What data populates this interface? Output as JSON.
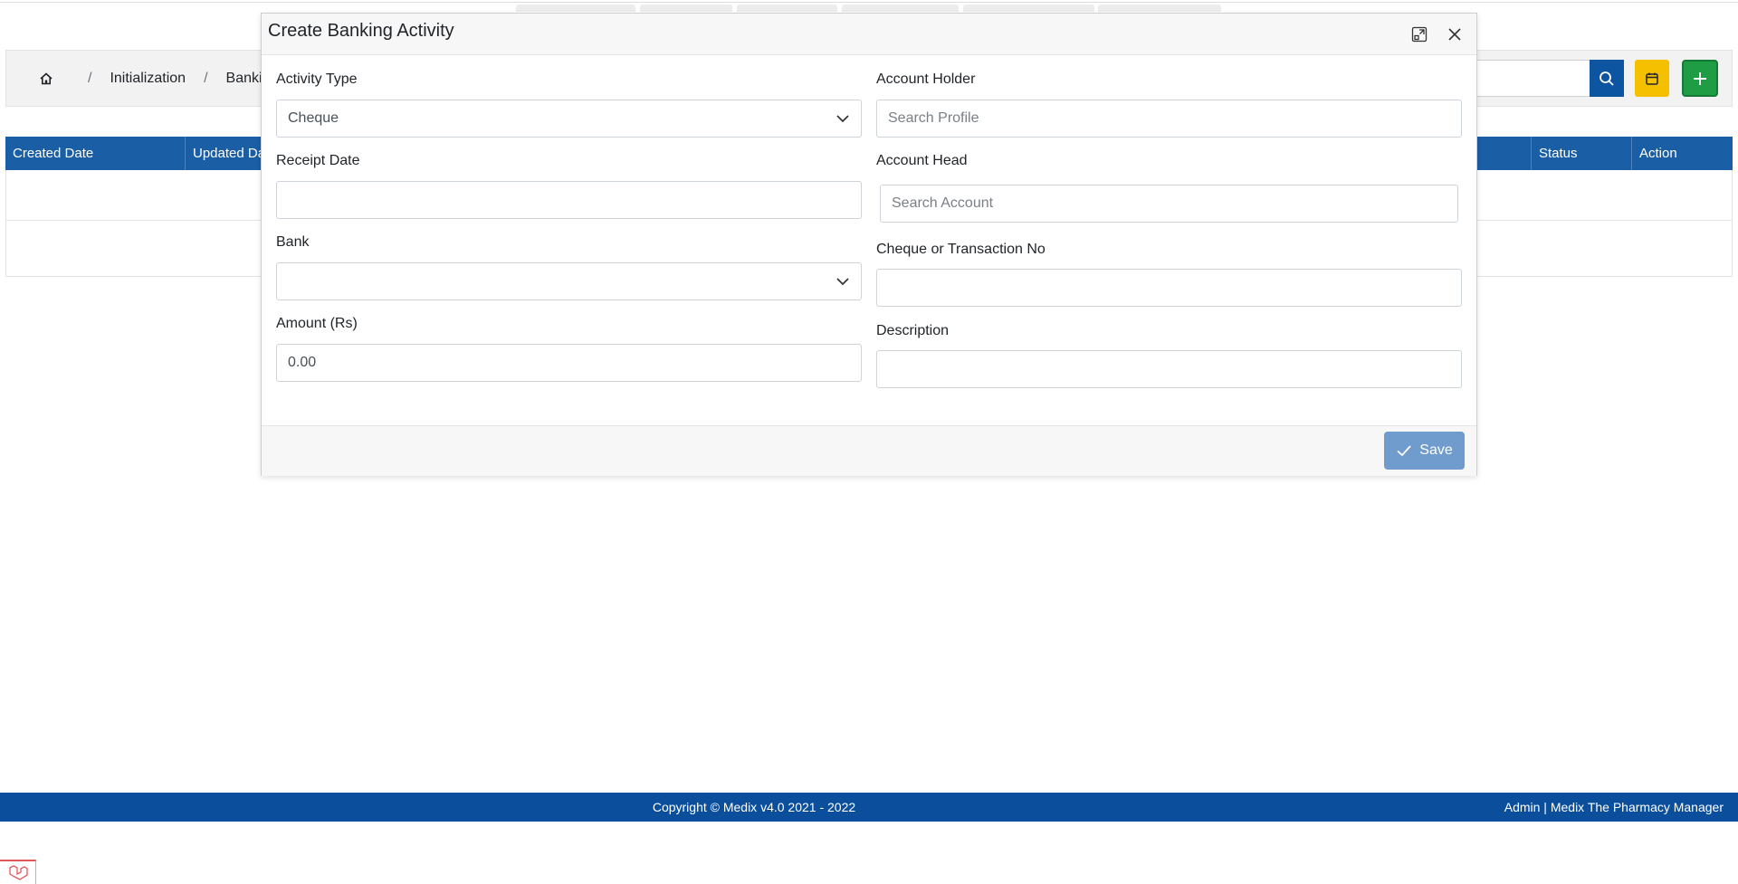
{
  "breadcrumb": {
    "items": [
      "Initialization",
      "Bankin"
    ]
  },
  "table": {
    "headers": [
      "Created Date",
      "Updated Da",
      "Status",
      "Action"
    ]
  },
  "modal": {
    "title": "Create Banking Activity",
    "fields": {
      "activity_type": {
        "label": "Activity Type",
        "value": "Cheque"
      },
      "account_holder": {
        "label": "Account Holder",
        "placeholder": "Search Profile"
      },
      "receipt_date": {
        "label": "Receipt Date",
        "value": ""
      },
      "account_head": {
        "label": "Account Head",
        "placeholder": "Search Account"
      },
      "bank": {
        "label": "Bank",
        "value": ""
      },
      "cheque_no": {
        "label": "Cheque or Transaction No",
        "value": ""
      },
      "amount": {
        "label": "Amount (Rs)",
        "value": "0.00"
      },
      "description": {
        "label": "Description",
        "value": ""
      }
    },
    "save_label": "Save"
  },
  "footer": {
    "copyright": "Copyright © Medix v4.0 2021 - 2022",
    "right": "Admin | Medix The Pharmacy Manager"
  },
  "colors": {
    "primary": "#1a5ea6",
    "footer": "#0b4f9c",
    "warning": "#f5c000",
    "success": "#1f9d44",
    "save": "#6f9ccc"
  },
  "icons": {
    "home": "home-icon",
    "search": "search-icon",
    "calendar": "calendar-icon",
    "add": "plus-icon",
    "expand": "expand-icon",
    "close": "close-icon",
    "check": "check-icon",
    "chevron": "chevron-down-icon",
    "logo": "laravel-logo-icon"
  }
}
